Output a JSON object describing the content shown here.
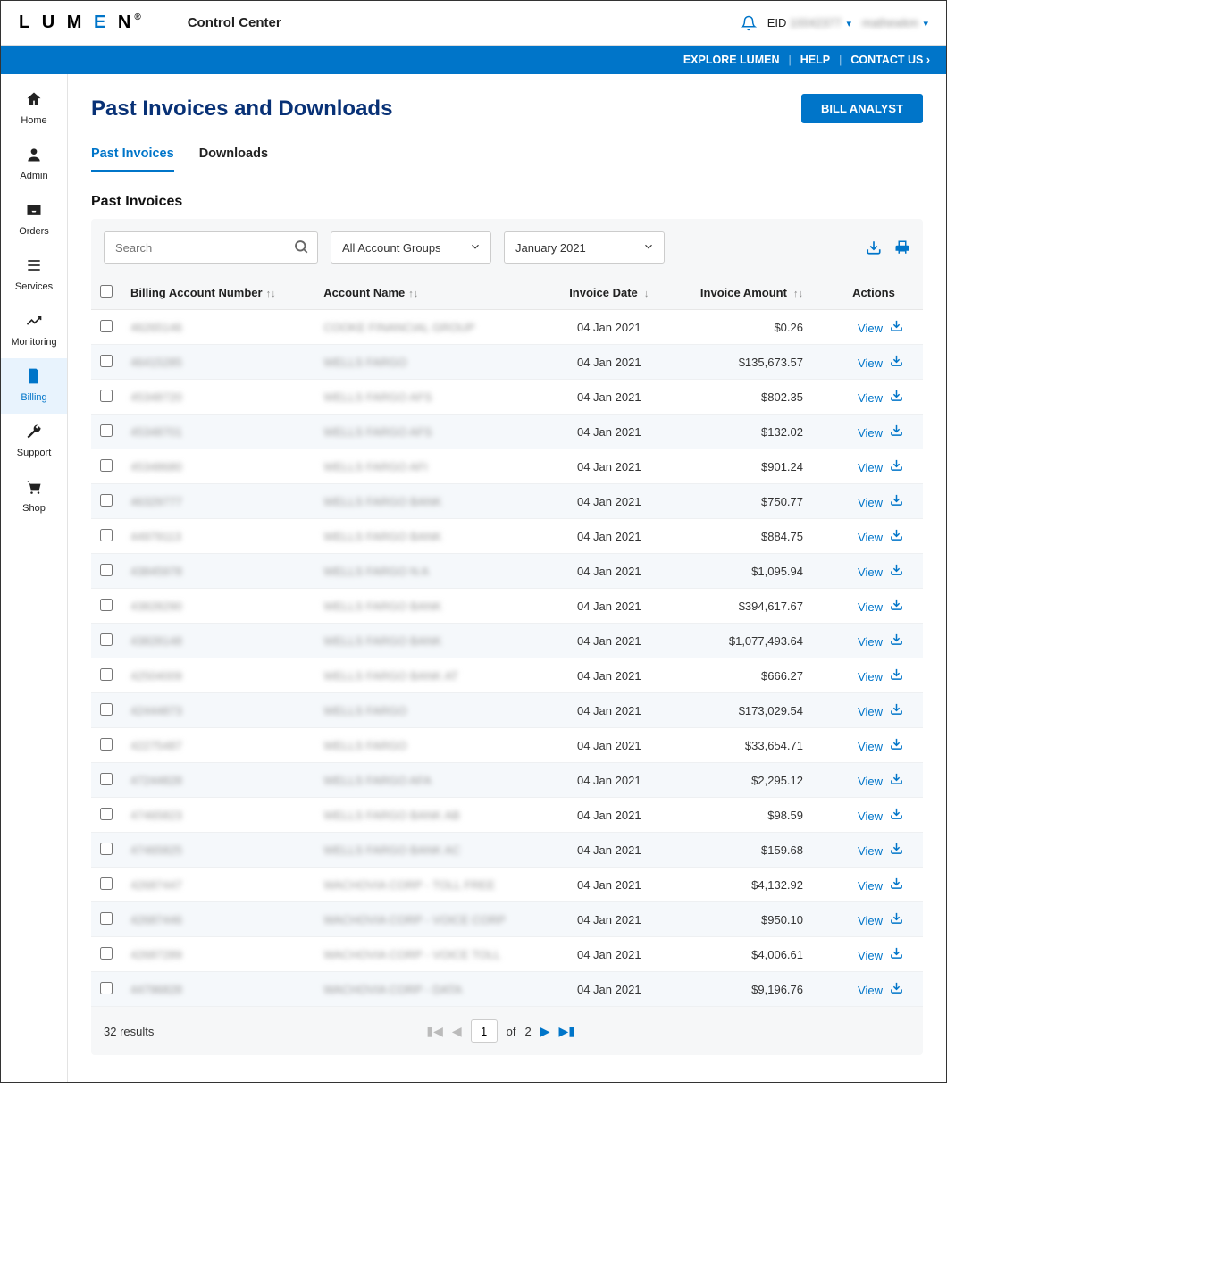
{
  "header": {
    "brand": "LUMEN",
    "app_title": "Control Center",
    "eid_label": "EID",
    "eid_value": "10042377",
    "user_name": "mathewkm"
  },
  "blue_nav": {
    "explore": "EXPLORE LUMEN",
    "help": "HELP",
    "contact": "CONTACT US"
  },
  "sidebar": {
    "items": [
      {
        "label": "Home",
        "icon": "home-icon"
      },
      {
        "label": "Admin",
        "icon": "user-circle-icon"
      },
      {
        "label": "Orders",
        "icon": "inbox-icon"
      },
      {
        "label": "Services",
        "icon": "list-icon"
      },
      {
        "label": "Monitoring",
        "icon": "chart-line-icon"
      },
      {
        "label": "Billing",
        "icon": "file-invoice-icon"
      },
      {
        "label": "Support",
        "icon": "wrench-icon"
      },
      {
        "label": "Shop",
        "icon": "cart-icon"
      }
    ],
    "active_index": 5
  },
  "page": {
    "title": "Past Invoices and Downloads",
    "bill_analyst_btn": "BILL ANALYST",
    "tabs": [
      {
        "label": "Past Invoices",
        "active": true
      },
      {
        "label": "Downloads",
        "active": false
      }
    ],
    "section_title": "Past Invoices"
  },
  "filters": {
    "search_placeholder": "Search",
    "account_group": "All Account Groups",
    "month": "January 2021"
  },
  "table": {
    "columns": {
      "billing_account": "Billing Account Number",
      "account_name": "Account Name",
      "invoice_date": "Invoice Date",
      "invoice_amount": "Invoice Amount",
      "actions": "Actions"
    },
    "action_view": "View",
    "rows": [
      {
        "ban": "46265146",
        "name": "COOKE FINANCIAL GROUP",
        "date": "04 Jan 2021",
        "amount": "$0.26"
      },
      {
        "ban": "46415285",
        "name": "WELLS FARGO",
        "date": "04 Jan 2021",
        "amount": "$135,673.57"
      },
      {
        "ban": "45348720",
        "name": "WELLS FARGO AFS",
        "date": "04 Jan 2021",
        "amount": "$802.35"
      },
      {
        "ban": "45348701",
        "name": "WELLS FARGO AFS",
        "date": "04 Jan 2021",
        "amount": "$132.02"
      },
      {
        "ban": "45348680",
        "name": "WELLS FARGO AFI",
        "date": "04 Jan 2021",
        "amount": "$901.24"
      },
      {
        "ban": "46329777",
        "name": "WELLS FARGO BANK",
        "date": "04 Jan 2021",
        "amount": "$750.77"
      },
      {
        "ban": "44979113",
        "name": "WELLS FARGO BANK",
        "date": "04 Jan 2021",
        "amount": "$884.75"
      },
      {
        "ban": "43845978",
        "name": "WELLS FARGO N A",
        "date": "04 Jan 2021",
        "amount": "$1,095.94"
      },
      {
        "ban": "43828290",
        "name": "WELLS FARGO BANK",
        "date": "04 Jan 2021",
        "amount": "$394,617.67"
      },
      {
        "ban": "43828148",
        "name": "WELLS FARGO BANK",
        "date": "04 Jan 2021",
        "amount": "$1,077,493.64"
      },
      {
        "ban": "42504009",
        "name": "WELLS FARGO BANK AT",
        "date": "04 Jan 2021",
        "amount": "$666.27"
      },
      {
        "ban": "42444873",
        "name": "WELLS FARGO",
        "date": "04 Jan 2021",
        "amount": "$173,029.54"
      },
      {
        "ban": "42275487",
        "name": "WELLS FARGO",
        "date": "04 Jan 2021",
        "amount": "$33,654.71"
      },
      {
        "ban": "47244828",
        "name": "WELLS FARGO AFA",
        "date": "04 Jan 2021",
        "amount": "$2,295.12"
      },
      {
        "ban": "47465823",
        "name": "WELLS FARGO BANK AB",
        "date": "04 Jan 2021",
        "amount": "$98.59"
      },
      {
        "ban": "47465825",
        "name": "WELLS FARGO BANK AC",
        "date": "04 Jan 2021",
        "amount": "$159.68"
      },
      {
        "ban": "42687447",
        "name": "WACHOVIA CORP - TOLL FREE",
        "date": "04 Jan 2021",
        "amount": "$4,132.92"
      },
      {
        "ban": "42687446",
        "name": "WACHOVIA CORP - VOICE CORP",
        "date": "04 Jan 2021",
        "amount": "$950.10"
      },
      {
        "ban": "42687289",
        "name": "WACHOVIA CORP - VOICE TOLL",
        "date": "04 Jan 2021",
        "amount": "$4,006.61"
      },
      {
        "ban": "44796828",
        "name": "WACHOVIA CORP - DATA",
        "date": "04 Jan 2021",
        "amount": "$9,196.76"
      }
    ]
  },
  "pager": {
    "results_text": "32 results",
    "current_page": "1",
    "of_label": "of",
    "total_pages": "2"
  }
}
